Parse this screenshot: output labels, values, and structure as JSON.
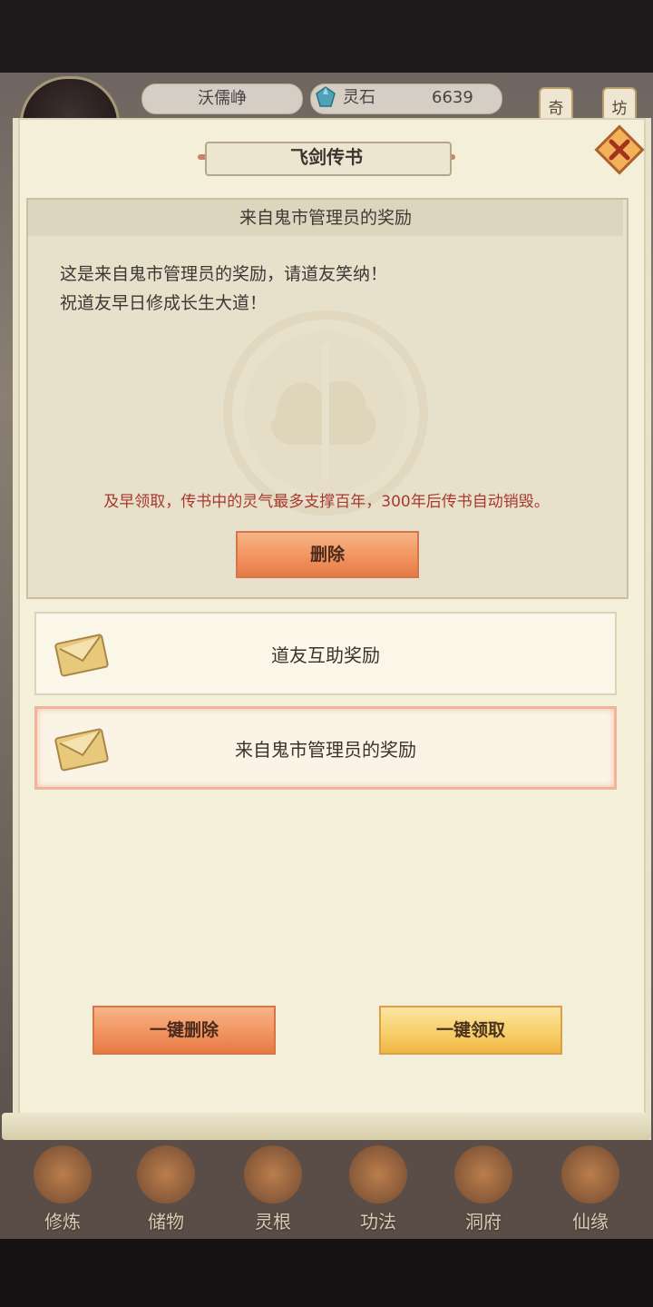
{
  "hud": {
    "player_name": "沃儒峥",
    "currency_label": "灵石",
    "currency_value": "6639",
    "side_buttons": [
      "奇",
      "坊"
    ]
  },
  "dialog": {
    "title": "飞剑传书",
    "message": {
      "header": "来自鬼市管理员的奖励",
      "lines": [
        "这是来自鬼市管理员的奖励，请道友笑纳！",
        "祝道友早日修成长生大道！"
      ],
      "warning": "及早领取，传书中的灵气最多支撑百年，300年后传书自动销毁。",
      "delete_label": "删除"
    },
    "mail_list": [
      {
        "title": "道友互助奖励",
        "selected": false
      },
      {
        "title": "来自鬼市管理员的奖励",
        "selected": true
      }
    ],
    "delete_all_label": "一键删除",
    "claim_all_label": "一键领取"
  },
  "bottom_nav": [
    {
      "label": "修炼"
    },
    {
      "label": "储物"
    },
    {
      "label": "灵根"
    },
    {
      "label": "功法"
    },
    {
      "label": "洞府"
    },
    {
      "label": "仙缘"
    }
  ]
}
